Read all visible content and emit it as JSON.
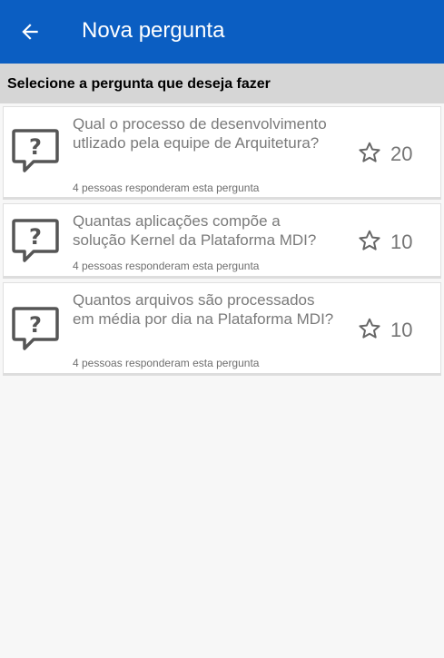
{
  "appbar": {
    "title": "Nova pergunta",
    "back_icon": "arrow-left-icon",
    "color": "#0b5ec2"
  },
  "section": {
    "title": "Selecione a pergunta que deseja fazer"
  },
  "questions": [
    {
      "text": "Qual o processo de desenvolvimento utlizado pela equipe de Arquitetura?",
      "responders": "4  pessoas responderam esta pergunta",
      "score": "20",
      "icon": "question-bubble-icon"
    },
    {
      "text": "Quantas aplicações compõe a solução Kernel da Plataforma MDI?",
      "responders": "4  pessoas responderam esta pergunta",
      "score": "10",
      "icon": "question-bubble-icon"
    },
    {
      "text": "Quantos arquivos são processados em média por dia na Plataforma MDI?",
      "responders": "4  pessoas responderam esta pergunta",
      "score": "10",
      "icon": "question-bubble-icon"
    }
  ]
}
